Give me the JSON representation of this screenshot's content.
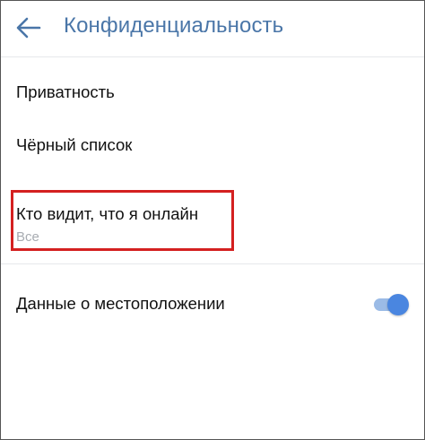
{
  "header": {
    "back_icon": "arrow-left-icon",
    "title": "Конфиденциальность"
  },
  "items": [
    {
      "label": "Приватность"
    },
    {
      "label": "Чёрный список"
    },
    {
      "label": "Кто видит, что я онлайн",
      "value": "Все",
      "highlighted": true
    },
    {
      "label": "Данные о местоположении",
      "toggle_on": true
    }
  ],
  "colors": {
    "accent": "#4a76a8",
    "toggle": "#4a86e0",
    "highlight": "#d42020",
    "secondary_text": "#a7abb1"
  }
}
